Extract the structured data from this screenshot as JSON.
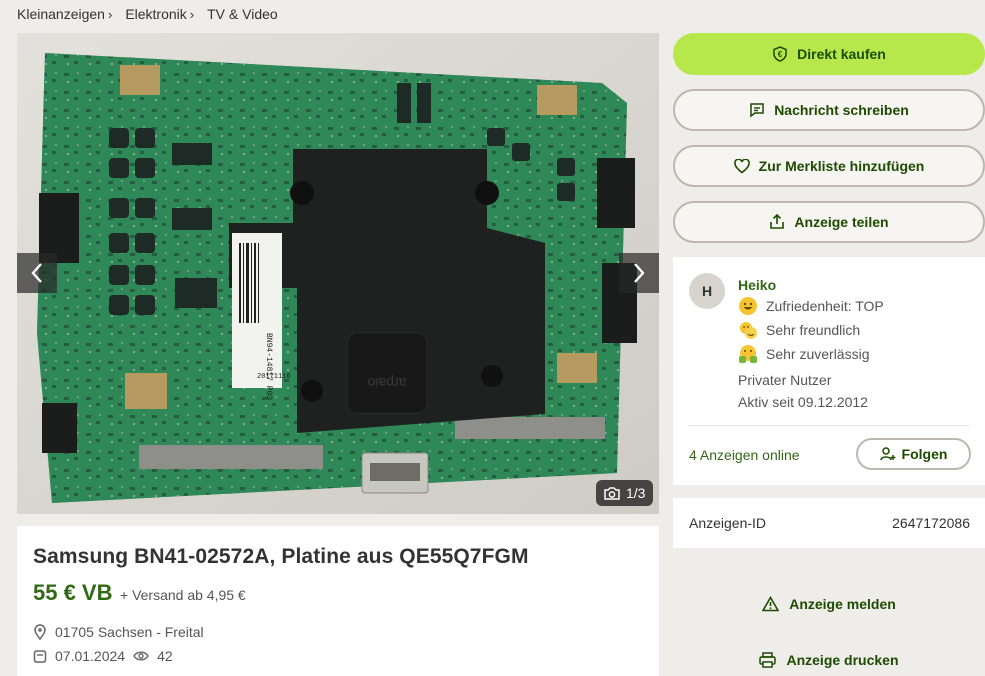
{
  "breadcrumb": [
    "Kleinanzeigen",
    "Elektronik",
    "TV & Video"
  ],
  "gallery": {
    "counter": "1/3",
    "label_code": "BN94-14817 P03",
    "label_date": "20171116",
    "chip_text": "arpaio"
  },
  "listing": {
    "title": "Samsung BN41-02572A, Platine aus QE55Q7FGM",
    "price": "55 € VB",
    "shipping": "+ Versand ab 4,95 €",
    "location": "01705 Sachsen - Freital",
    "date": "07.01.2024",
    "views": "42"
  },
  "actions": {
    "buy": "Direkt kaufen",
    "message": "Nachricht schreiben",
    "watchlist": "Zur Merkliste hinzufügen",
    "share": "Anzeige teilen"
  },
  "seller": {
    "avatar_letter": "H",
    "name": "Heiko",
    "badges": [
      "Zufriedenheit: TOP",
      "Sehr freundlich",
      "Sehr zuverlässig"
    ],
    "type": "Privater Nutzer",
    "active_since": "Aktiv seit 09.12.2012",
    "ads_online": "4 Anzeigen online",
    "follow": "Folgen"
  },
  "ad_id": {
    "label": "Anzeigen-ID",
    "value": "2647172086"
  },
  "links": {
    "report": "Anzeige melden",
    "print": "Anzeige drucken"
  },
  "colors": {
    "primary": "#b6e84c",
    "accent_text": "#326916",
    "page_bg": "#efede9"
  }
}
